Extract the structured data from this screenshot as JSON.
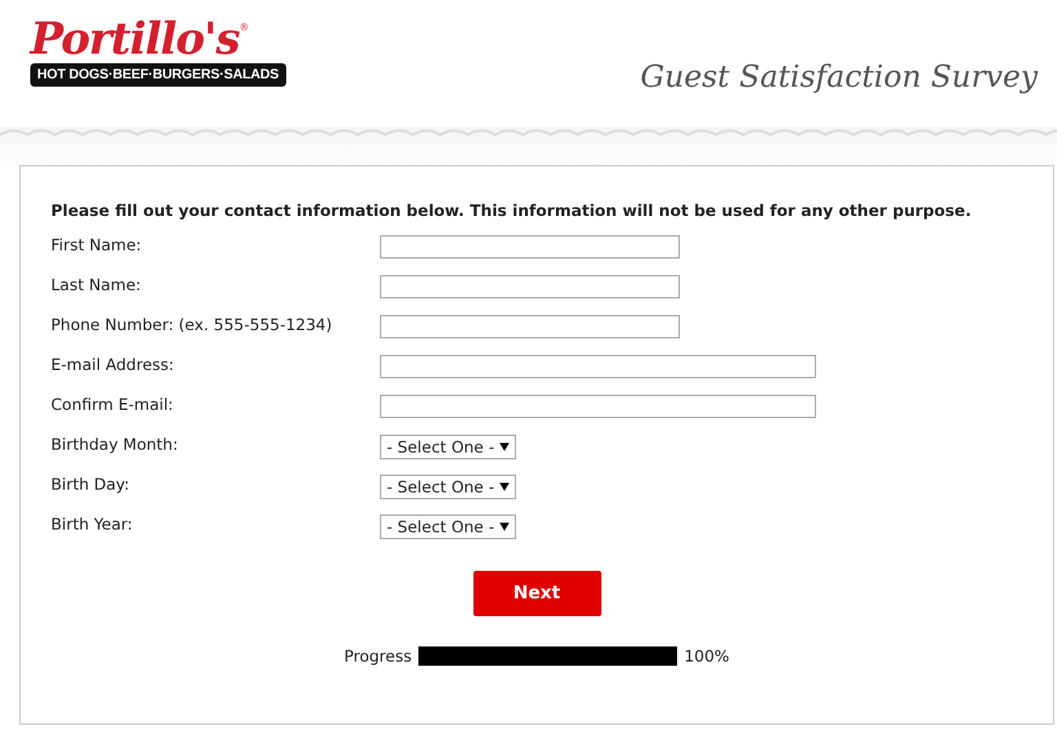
{
  "header": {
    "logo": "Portillo's",
    "logo_mark": "®",
    "tagline": "HOT DOGS·BEEF·BURGERS·SALADS",
    "title": "Guest Satisfaction Survey"
  },
  "form": {
    "intro": "Please fill out your contact information below. This information will not be used for any other purpose.",
    "fields": [
      {
        "label": "First Name:",
        "kind": "short"
      },
      {
        "label": "Last Name:",
        "kind": "short"
      },
      {
        "label": "Phone Number: (ex. 555-555-1234)",
        "kind": "short"
      },
      {
        "label": "E-mail Address:",
        "kind": "long"
      },
      {
        "label": "Confirm E-mail:",
        "kind": "long"
      },
      {
        "label": "Birthday Month:",
        "kind": "select",
        "value": "- Select One -"
      },
      {
        "label": "Birth Day:",
        "kind": "select",
        "value": "- Select One -"
      },
      {
        "label": "Birth Year:",
        "kind": "select",
        "value": "- Select One -"
      }
    ],
    "button": "Next",
    "progress": {
      "label": "Progress",
      "level": 1,
      "reading": "100%"
    }
  }
}
